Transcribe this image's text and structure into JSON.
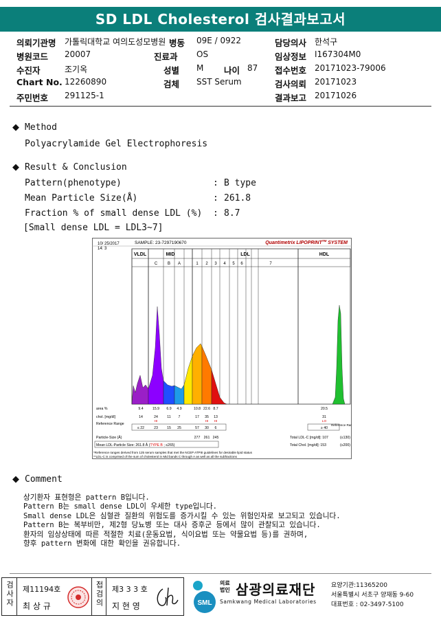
{
  "title": "SD LDL Cholesterol 검사결과보고서",
  "header": {
    "fields": [
      {
        "label": "의뢰기관명",
        "value": "가톨릭대학교 여의도성모병원"
      },
      {
        "label": "병동",
        "value": "09E / 0922"
      },
      {
        "label": "담당의사",
        "value": "한석구"
      },
      {
        "label": "병원코드",
        "value": "20007"
      },
      {
        "label": "진료과",
        "value": "OS"
      },
      {
        "label": "임상정보",
        "value": "I167304M0"
      },
      {
        "label": "수진자",
        "value": "조기옥"
      },
      {
        "label": "성별",
        "value": "M"
      },
      {
        "label": "나이",
        "value": "87"
      },
      {
        "label": "접수번호",
        "value": "20171023-79006"
      },
      {
        "label": "Chart No.",
        "value": "12260890"
      },
      {
        "label": "검체",
        "value": "SST Serum"
      },
      {
        "label": "검사의뢰",
        "value": "20171023"
      },
      {
        "label": "주민번호",
        "value": "291125-1"
      },
      {
        "label": "결과보고",
        "value": "20171026"
      }
    ]
  },
  "method": {
    "heading": "Method",
    "text": "Polyacrylamide Gel Electrophoresis"
  },
  "result": {
    "heading": "Result & Conclusion",
    "rows": [
      {
        "key": "Pattern(phenotype)",
        "sep": ":",
        "value": "B type"
      },
      {
        "key": "Mean Particle Size(Å)",
        "sep": ":",
        "value": "261.8"
      },
      {
        "key": "Fraction % of small dense LDL (%)",
        "sep": ":",
        "value": "8.7"
      }
    ],
    "note": "[Small dense LDL = LDL3~7]"
  },
  "chart_data": {
    "type": "area",
    "date": "10/ 25/2017",
    "time": "14: 3",
    "sample": "SAMPLE:  23-7297190670",
    "brand": "Quantimetrix LIPOPRINT",
    "brand_tm": "TM",
    "brand_suffix": " SYSTEM",
    "band_groups": [
      "VLDL",
      "MID",
      "LDL",
      "HDL"
    ],
    "bands": [
      "C",
      "B",
      "A",
      "1",
      "2",
      "3",
      "4",
      "5",
      "6",
      "7"
    ],
    "row_labels": {
      "area": "area %",
      "chol": "chol. [mg/dl]",
      "ref": "Reference Range",
      "size": "Particle-Size (Å)",
      "mean": "Mean LDL-Particle Size"
    },
    "area_pct": [
      "9.4",
      "15.9",
      "6.9",
      "4.9",
      "10.8",
      "22.6",
      "8.7",
      "20.5"
    ],
    "chol": [
      "14",
      "24",
      "11",
      "7",
      "17",
      "35",
      "13",
      "31"
    ],
    "flags": [
      "HI",
      "HI",
      "HI",
      "LO"
    ],
    "ref_values": [
      "≤ 22",
      "23",
      "15",
      "25",
      "57",
      "30",
      "6",
      "≥ 40"
    ],
    "ref_right": "Reference Range",
    "particle_size": [
      "277",
      "261",
      "245"
    ],
    "mean_size": "261.8 Å",
    "mean_type": "TYPE B",
    "mean_rule": "≤265",
    "total_ldl": "Total LDL-C [mg/dl]:  107",
    "total_ldl_ref": "(≤130)",
    "total_chol": "Total Chol. [mg/dl]:  153",
    "total_chol_ref": "(≤200)",
    "footnote1": "*Reference ranges derived from 125 serum samples that met the NCEP ATPIII guidelines for desirable lipid status",
    "footnote2": "**LDL-C is comprised of the sum of cholesterol in Mid bands C through A as well as all the subfractions"
  },
  "comment": {
    "heading": "Comment",
    "lines": [
      "상기환자 표현형은 pattern B입니다.",
      "Pattern B는 small dense LDL이 우세한 type입니다.",
      "Small dense LDL은 심혈관 질환의 위험도를 증가시킬 수 있는 위험인자로 보고되고 있습니다.",
      "Pattern B는 복부비만, 제2형 당뇨병 또는 대사 증후군 등에서 많이 관찰되고 있습니다.",
      "환자의 임상상태에 따른 적절한 치료(운동요법, 식이요법 또는 약물요법 등)를 권하며,",
      "향후 pattern 변화에 대한 확인을 권유합니다."
    ]
  },
  "footer": {
    "tester_label": "검사자",
    "tester_no": "제11194호",
    "tester_name": "최 상 규",
    "approver_label": "접검의",
    "approver_no": "제3 3 3 호",
    "approver_name": "지 현 영",
    "org_prefix1": "의료",
    "org_prefix2": "법인",
    "org_name": "삼광의료재단",
    "org_eng": "Samkwang Medical Laboratories",
    "logo_text": "SML",
    "code": "요양기관:11365200",
    "address": "서울특별시 서초구 양재동 9-60",
    "phone": "대표번호 : 02-3497-5100"
  }
}
